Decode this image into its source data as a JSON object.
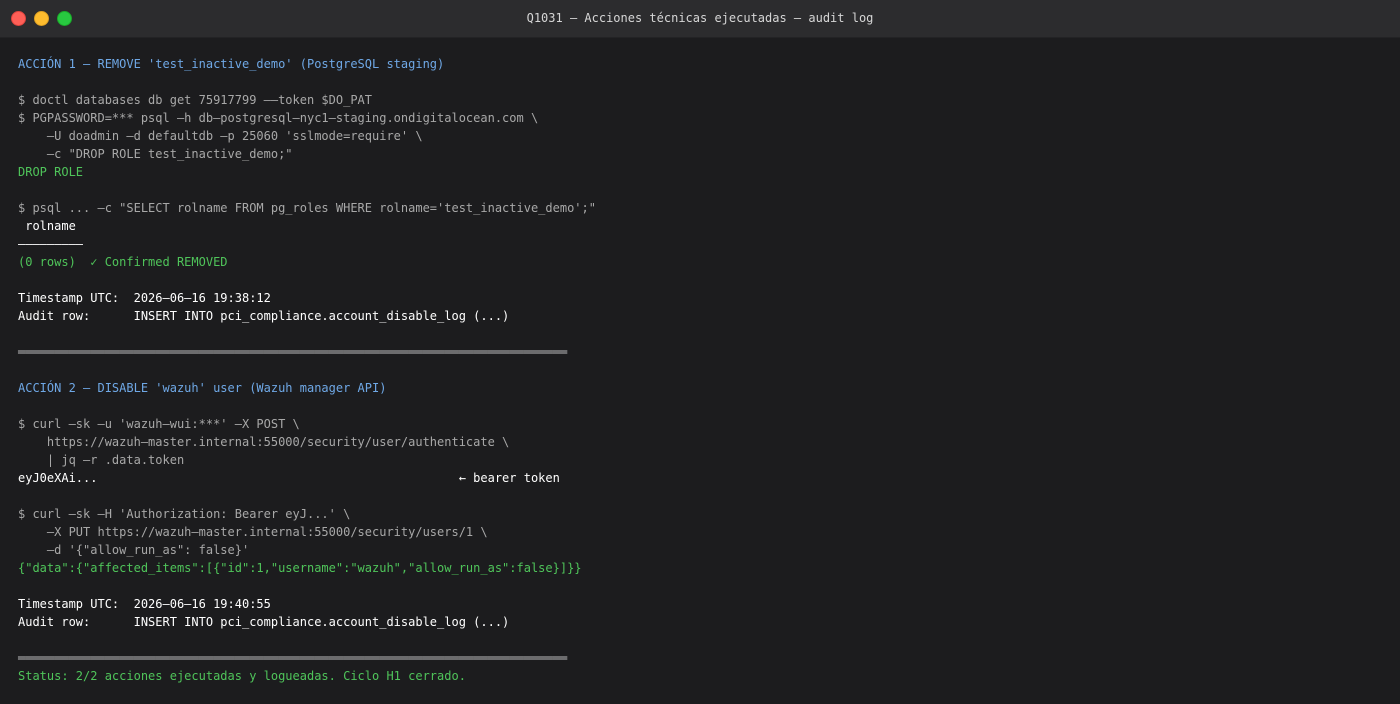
{
  "window": {
    "title": "Q1031 — Acciones técnicas ejecutadas — audit log"
  },
  "terminal": {
    "lines": [
      {
        "text": "ACCIÓN 1 — REMOVE 'test_inactive_demo' (PostgreSQL staging)",
        "type": "header"
      },
      {
        "text": "",
        "type": "blank"
      },
      {
        "text": "$ doctl databases db get 75917799 ——token $DO_PAT",
        "type": "cmd"
      },
      {
        "text": "$ PGPASSWORD=*** psql —h db—postgresql—nyc1—staging.ondigitalocean.com \\",
        "type": "cmd"
      },
      {
        "text": "    —U doadmin —d defaultdb —p 25060 'sslmode=require' \\",
        "type": "cmd"
      },
      {
        "text": "    —c \"DROP ROLE test_inactive_demo;\"",
        "type": "cmd"
      },
      {
        "text": "DROP ROLE",
        "type": "ok"
      },
      {
        "text": "",
        "type": "blank"
      },
      {
        "text": "$ psql ... —c \"SELECT rolname FROM pg_roles WHERE rolname='test_inactive_demo';\"",
        "type": "cmd"
      },
      {
        "text": " rolname",
        "type": "white"
      },
      {
        "text": "—————————",
        "type": "white"
      },
      {
        "text": "(0 rows)  ✓ Confirmed REMOVED",
        "type": "ok"
      },
      {
        "text": "",
        "type": "blank"
      },
      {
        "text": "Timestamp UTC:  2026—06—16 19:38:12",
        "type": "white"
      },
      {
        "text": "Audit row:      INSERT INTO pci_compliance.account_disable_log (...)",
        "type": "white"
      },
      {
        "text": "",
        "type": "blank"
      },
      {
        "text": "════════════════════════════════════════════════════════════════════════════",
        "type": "sep"
      },
      {
        "text": "",
        "type": "blank"
      },
      {
        "text": "ACCIÓN 2 — DISABLE 'wazuh' user (Wazuh manager API)",
        "type": "header"
      },
      {
        "text": "",
        "type": "blank"
      },
      {
        "text": "$ curl —sk —u 'wazuh—wui:***' —X POST \\",
        "type": "cmd"
      },
      {
        "text": "    https://wazuh—master.internal:55000/security/user/authenticate \\",
        "type": "cmd"
      },
      {
        "text": "    | jq —r .data.token",
        "type": "cmd"
      },
      {
        "text": "eyJ0eXAi...                                                  ← bearer token",
        "type": "white"
      },
      {
        "text": "",
        "type": "blank"
      },
      {
        "text": "$ curl —sk —H 'Authorization: Bearer eyJ...' \\",
        "type": "cmd"
      },
      {
        "text": "    —X PUT https://wazuh—master.internal:55000/security/users/1 \\",
        "type": "cmd"
      },
      {
        "text": "    —d '{\"allow_run_as\": false}'",
        "type": "cmd"
      },
      {
        "text": "{\"data\":{\"affected_items\":[{\"id\":1,\"username\":\"wazuh\",\"allow_run_as\":false}]}}",
        "type": "ok"
      },
      {
        "text": "",
        "type": "blank"
      },
      {
        "text": "Timestamp UTC:  2026—06—16 19:40:55",
        "type": "white"
      },
      {
        "text": "Audit row:      INSERT INTO pci_compliance.account_disable_log (...)",
        "type": "white"
      },
      {
        "text": "",
        "type": "blank"
      },
      {
        "text": "════════════════════════════════════════════════════════════════════════════",
        "type": "sep"
      },
      {
        "text": "Status: 2/2 acciones ejecutadas y logueadas. Ciclo H1 cerrado.",
        "type": "ok"
      }
    ]
  },
  "colors": {
    "header": "#6fa8e6",
    "cmd": "#a8a8a8",
    "ok": "#4fc45a",
    "white": "#ffffff",
    "background": "#1c1c1e"
  }
}
